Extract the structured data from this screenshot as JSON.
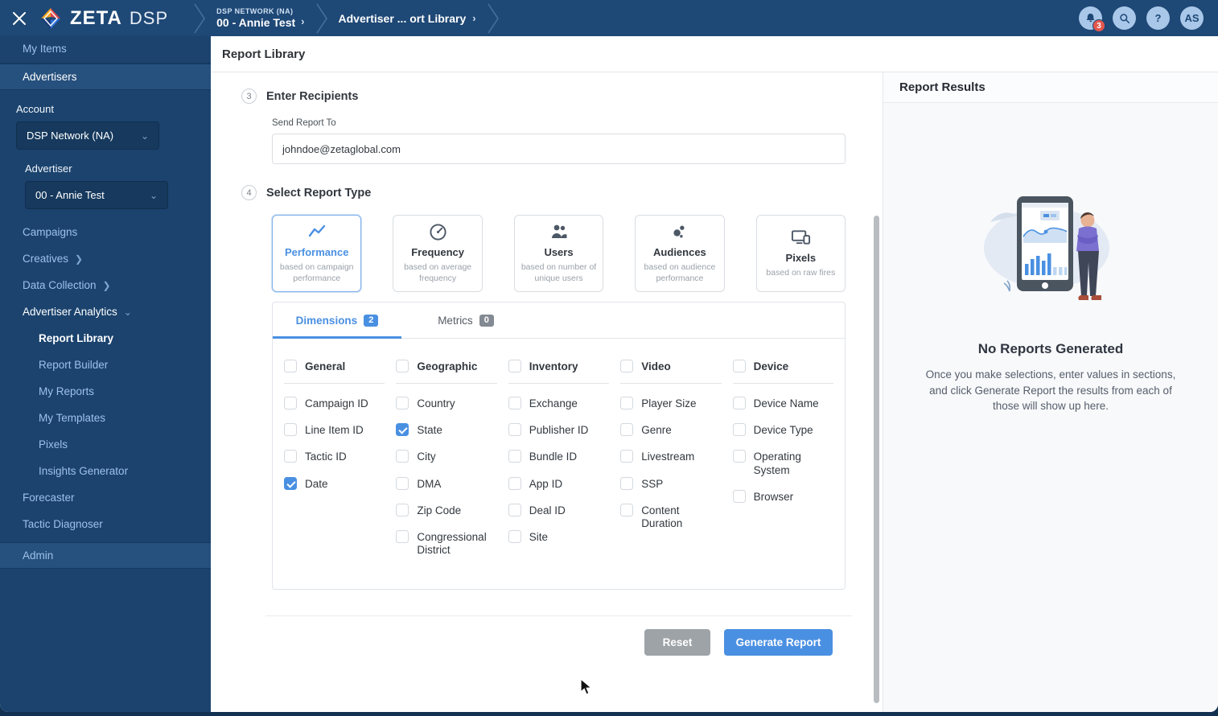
{
  "colors": {
    "accent": "#4a90e2",
    "topbar": "#1E4876",
    "sidebar": "#1B436E",
    "badge_red": "#E2574C"
  },
  "topbar": {
    "brand_name": "ZETA",
    "brand_suffix": "DSP",
    "breadcrumb_account_label": "DSP NETWORK (NA)",
    "breadcrumb_account_value": "00 - Annie Test",
    "breadcrumb_page": "Advertiser ... ort Library",
    "notification_count": "3",
    "help_label": "?",
    "avatar_initials": "AS"
  },
  "sidebar": {
    "my_items": "My Items",
    "advertisers": "Advertisers",
    "account_label": "Account",
    "account_value": "DSP Network (NA)",
    "advertiser_label": "Advertiser",
    "advertiser_value": "00 - Annie Test",
    "campaigns": "Campaigns",
    "creatives": "Creatives",
    "data_collection": "Data Collection",
    "advertiser_analytics": "Advertiser Analytics",
    "analytics_items": [
      {
        "label": "Report Library",
        "active": true
      },
      {
        "label": "Report Builder",
        "active": false
      },
      {
        "label": "My Reports",
        "active": false
      },
      {
        "label": "My Templates",
        "active": false
      },
      {
        "label": "Pixels",
        "active": false
      },
      {
        "label": "Insights Generator",
        "active": false
      }
    ],
    "forecaster": "Forecaster",
    "tactic_diagnoser": "Tactic Diagnoser",
    "admin": "Admin"
  },
  "page": {
    "title": "Report Library"
  },
  "recipients": {
    "step": "3",
    "title": "Enter Recipients",
    "field_label": "Send Report To",
    "value": "johndoe@zetaglobal.com"
  },
  "report_type": {
    "step": "4",
    "title": "Select Report Type",
    "cards": [
      {
        "title": "Performance",
        "desc": "based on campaign performance",
        "icon": "line-chart-icon",
        "selected": true
      },
      {
        "title": "Frequency",
        "desc": "based on average frequency",
        "icon": "gauge-icon",
        "selected": false
      },
      {
        "title": "Users",
        "desc": "based on number of unique users",
        "icon": "users-icon",
        "selected": false
      },
      {
        "title": "Audiences",
        "desc": "based on audience performance",
        "icon": "bubbles-icon",
        "selected": false
      },
      {
        "title": "Pixels",
        "desc": "based on raw fires",
        "icon": "devices-icon",
        "selected": false
      }
    ]
  },
  "dimensions_panel": {
    "tabs": [
      {
        "label": "Dimensions",
        "count": "2",
        "active": true
      },
      {
        "label": "Metrics",
        "count": "0",
        "active": false
      }
    ],
    "columns": [
      {
        "group": "General",
        "items": [
          {
            "label": "Campaign ID",
            "checked": false
          },
          {
            "label": "Line Item ID",
            "checked": false
          },
          {
            "label": "Tactic ID",
            "checked": false
          },
          {
            "label": "Date",
            "checked": true
          }
        ]
      },
      {
        "group": "Geographic",
        "items": [
          {
            "label": "Country",
            "checked": false
          },
          {
            "label": "State",
            "checked": true
          },
          {
            "label": "City",
            "checked": false
          },
          {
            "label": "DMA",
            "checked": false
          },
          {
            "label": "Zip Code",
            "checked": false
          },
          {
            "label": "Congressional District",
            "checked": false
          }
        ]
      },
      {
        "group": "Inventory",
        "items": [
          {
            "label": "Exchange",
            "checked": false
          },
          {
            "label": "Publisher ID",
            "checked": false
          },
          {
            "label": "Bundle ID",
            "checked": false
          },
          {
            "label": "App ID",
            "checked": false
          },
          {
            "label": "Deal ID",
            "checked": false
          },
          {
            "label": "Site",
            "checked": false
          }
        ]
      },
      {
        "group": "Video",
        "items": [
          {
            "label": "Player Size",
            "checked": false
          },
          {
            "label": "Genre",
            "checked": false
          },
          {
            "label": "Livestream",
            "checked": false
          },
          {
            "label": "SSP",
            "checked": false
          },
          {
            "label": "Content Duration",
            "checked": false
          }
        ]
      },
      {
        "group": "Device",
        "items": [
          {
            "label": "Device Name",
            "checked": false
          },
          {
            "label": "Device Type",
            "checked": false
          },
          {
            "label": "Operating System",
            "checked": false
          },
          {
            "label": "Browser",
            "checked": false
          }
        ]
      }
    ]
  },
  "actions": {
    "reset": "Reset",
    "generate": "Generate Report"
  },
  "results": {
    "title": "Report Results",
    "empty_title": "No Reports Generated",
    "empty_text": "Once you make selections, enter values in sections, and click Generate Report the results from each of those will show up here."
  }
}
